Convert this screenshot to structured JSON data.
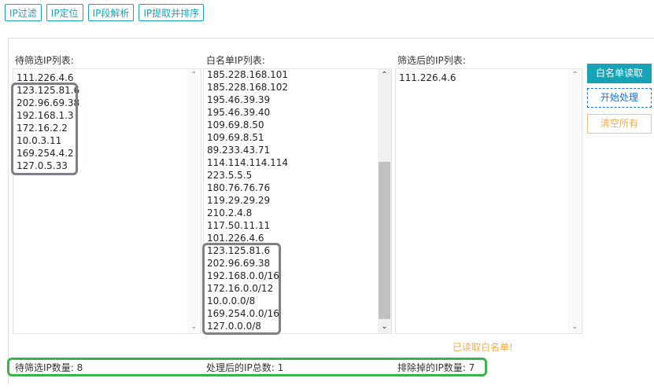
{
  "tabs": [
    "IP过滤",
    "IP定位",
    "IP段解析",
    "IP提取并排序"
  ],
  "columns": {
    "pending": {
      "label": "待筛选IP列表:",
      "items": [
        "111.226.4.6",
        "123.125.81.6",
        "202.96.69.38",
        "192.168.1.3",
        "172.16.2.2",
        "10.0.3.11",
        "169.254.4.2",
        "127.0.5.33"
      ]
    },
    "whitelist": {
      "label": "白名单IP列表:",
      "items": [
        "185.228.168.101",
        "185.228.168.102",
        "195.46.39.39",
        "195.46.39.40",
        "109.69.8.50",
        "109.69.8.51",
        "89.233.43.71",
        "114.114.114.114",
        "223.5.5.5",
        "180.76.76.76",
        "119.29.29.29",
        "210.2.4.8",
        "117.50.11.11",
        "101.226.4.6",
        "123.125.81.6",
        "202.96.69.38",
        "192.168.0.0/16",
        "172.16.0.0/12",
        "10.0.0.0/8",
        "169.254.0.0/16",
        "127.0.0.0/8"
      ]
    },
    "result": {
      "label": "筛选后的IP列表:",
      "items": [
        "111.226.4.6"
      ]
    }
  },
  "buttons": {
    "read_whitelist": "白名单读取",
    "start": "开始处理",
    "clear": "清空所有"
  },
  "status_note": "已读取白名单!",
  "stats": {
    "pending_count": "待筛选IP数量: 8",
    "processed_total": "处理后的IP总数: 1",
    "excluded_count": "排除掉的IP数量: 7"
  },
  "colors": {
    "accent": "#17a2b8",
    "warning": "#f0ad4e",
    "highlight_gray": "#7d8087",
    "highlight_green": "#3cb34a"
  }
}
